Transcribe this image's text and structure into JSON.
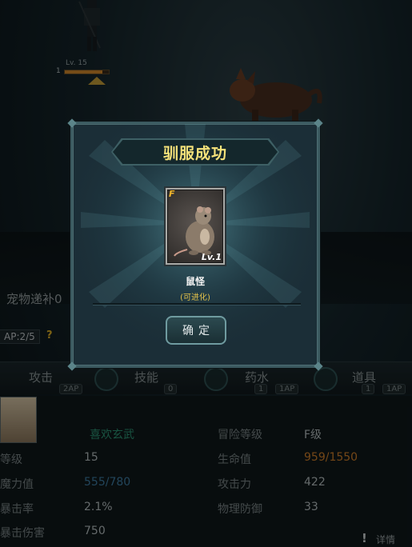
{
  "hero": {
    "level_text": "Lv. 15",
    "hp_left_number": "1",
    "hp_fraction": 0.85
  },
  "pet_panel": {
    "title": "宠物递补0",
    "ap": "AP:2/5",
    "help": "?"
  },
  "actions": [
    {
      "label": "攻击",
      "badge": "2AP"
    },
    {
      "label": "技能",
      "badge": "0"
    },
    {
      "label": "药水",
      "badge": "1",
      "badge2": "1AP"
    },
    {
      "label": "道具",
      "badge": "1",
      "badge2": "1AP"
    }
  ],
  "stats": {
    "name": "喜欢玄武",
    "left": [
      {
        "label": "等级",
        "value": "15"
      },
      {
        "label": "魔力值",
        "value": "555/780"
      },
      {
        "label": "暴击率",
        "value": "2.1%"
      },
      {
        "label": "暴击伤害",
        "value": "750"
      }
    ],
    "right": [
      {
        "label": "冒险等级",
        "value": "F级"
      },
      {
        "label": "生命值",
        "value": "959/1550"
      },
      {
        "label": "攻击力",
        "value": "422"
      },
      {
        "label": "物理防御",
        "value": "33"
      }
    ],
    "detail": "详情",
    "detail_icon": "!"
  },
  "modal": {
    "title": "驯服成功",
    "card": {
      "grade": "F",
      "level": "Lv.1"
    },
    "pet_name": "鼠怪",
    "pet_note": "(可进化)",
    "confirm": "确定"
  },
  "colors": {
    "title": "#f6e27a",
    "hp_value": "#d4822b",
    "mp_value": "#3f7fa6",
    "name": "#2e9a78"
  }
}
